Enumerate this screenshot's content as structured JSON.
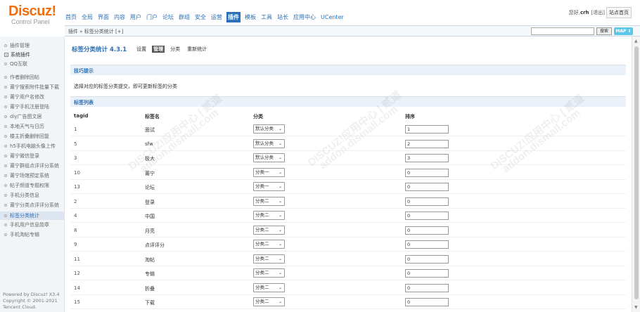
{
  "logo": {
    "brand": "Discuz!",
    "sub": "Control Panel"
  },
  "topnav": [
    {
      "label": "首页",
      "active": false
    },
    {
      "label": "全局",
      "active": false
    },
    {
      "label": "界面",
      "active": false
    },
    {
      "label": "内容",
      "active": false
    },
    {
      "label": "用户",
      "active": false
    },
    {
      "label": "门户",
      "active": false
    },
    {
      "label": "论坛",
      "active": false
    },
    {
      "label": "群组",
      "active": false
    },
    {
      "label": "安全",
      "active": false
    },
    {
      "label": "运营",
      "active": false
    },
    {
      "label": "插件",
      "active": true
    },
    {
      "label": "模板",
      "active": false
    },
    {
      "label": "工具",
      "active": false
    },
    {
      "label": "站长",
      "active": false
    },
    {
      "label": "应用中心",
      "active": false
    },
    {
      "label": "UCenter",
      "active": false
    }
  ],
  "userbar": {
    "prefix": "您好,",
    "username": "crh",
    "logout": "[退出]",
    "home": "站点首页"
  },
  "crumb": "插件 » 标签分类统计 [+]",
  "search": {
    "button": "搜索",
    "map": "MAP ⇕"
  },
  "sidebar": {
    "items": [
      {
        "label": "插件管理",
        "type": "item"
      },
      {
        "label": "系统插件",
        "type": "group"
      },
      {
        "label": "QQ互联",
        "type": "item"
      },
      {
        "label": "作者删除回帖",
        "type": "item"
      },
      {
        "label": "莆宁搜索附件批量下载",
        "type": "item"
      },
      {
        "label": "莆宁用户名修改",
        "type": "item"
      },
      {
        "label": "莆宁手机注册登陆",
        "type": "item"
      },
      {
        "label": "diy广告图文居",
        "type": "item"
      },
      {
        "label": "本地天气与日历",
        "type": "item"
      },
      {
        "label": "楼主折叠删除回复",
        "type": "item"
      },
      {
        "label": "h5手机电脑头像上传",
        "type": "item"
      },
      {
        "label": "莆宁微信登录",
        "type": "item"
      },
      {
        "label": "莆宁群组点评评分系统",
        "type": "item"
      },
      {
        "label": "莆宁场馆预定系统",
        "type": "item"
      },
      {
        "label": "帖子频道专题权限",
        "type": "item"
      },
      {
        "label": "手机分类信息",
        "type": "item"
      },
      {
        "label": "莆宁分类点评评分系统",
        "type": "item"
      },
      {
        "label": "标签分类统计",
        "type": "active"
      },
      {
        "label": "手机用户信息勋章",
        "type": "item"
      },
      {
        "label": "手机淘帖专辑",
        "type": "item"
      }
    ],
    "footer": [
      "Powered by Discuz! X3.4",
      "Copyright © 2001-2021",
      "Tencent Cloud."
    ]
  },
  "page": {
    "title": "标签分类统计 4.3.1",
    "tabs": [
      {
        "label": "设置",
        "active": false
      },
      {
        "label": "管理",
        "active": true
      },
      {
        "label": "分类",
        "active": false
      },
      {
        "label": "重新统计",
        "active": false
      }
    ],
    "tips_heading": "技巧提示",
    "tips_text": "选择对应的标签分类提交，即可更新标签的分类",
    "list_heading": "标签列表",
    "columns": {
      "tagid": "tagid",
      "name": "标签名",
      "cat": "分类",
      "order": "排序"
    }
  },
  "rows": [
    {
      "tagid": "1",
      "name": "面试",
      "cat": "默认分类",
      "order": "1"
    },
    {
      "tagid": "5",
      "name": "sfw",
      "cat": "默认分类",
      "order": "2"
    },
    {
      "tagid": "3",
      "name": "极大",
      "cat": "默认分类",
      "order": "3"
    },
    {
      "tagid": "10",
      "name": "莆宁",
      "cat": "分类一",
      "order": "0"
    },
    {
      "tagid": "13",
      "name": "论坛",
      "cat": "分类一",
      "order": "0"
    },
    {
      "tagid": "2",
      "name": "登录",
      "cat": "分类二",
      "order": "0"
    },
    {
      "tagid": "4",
      "name": "中国",
      "cat": "分类二",
      "order": "0"
    },
    {
      "tagid": "8",
      "name": "月亮",
      "cat": "分类二",
      "order": "0"
    },
    {
      "tagid": "9",
      "name": "点评评分",
      "cat": "分类二",
      "order": "0"
    },
    {
      "tagid": "11",
      "name": "淘帖",
      "cat": "分类二",
      "order": "0"
    },
    {
      "tagid": "12",
      "name": "专辑",
      "cat": "分类二",
      "order": "0"
    },
    {
      "tagid": "14",
      "name": "折叠",
      "cat": "分类二",
      "order": "0"
    },
    {
      "tagid": "15",
      "name": "下载",
      "cat": "分类二",
      "order": "0"
    }
  ],
  "watermark": [
    "DISCUZ!应用中心 | 贰道",
    "addon.dismall.com"
  ]
}
